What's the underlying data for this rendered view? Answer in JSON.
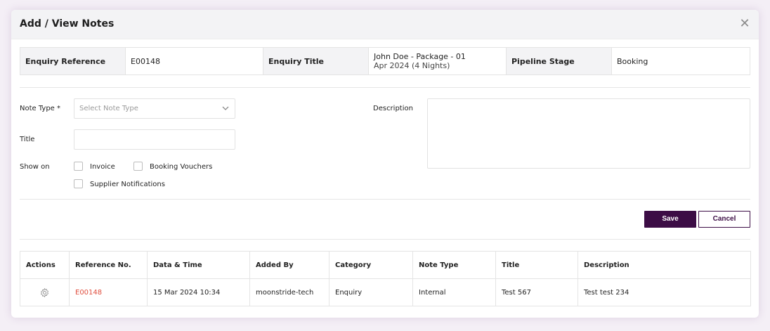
{
  "modal": {
    "title": "Add / View Notes",
    "close_icon": "close-icon"
  },
  "enquiry": {
    "reference_label": "Enquiry Reference",
    "reference_value": "E00148",
    "title_label": "Enquiry Title",
    "title_value_line1": "John Doe - Package - 01",
    "title_value_line2": "Apr 2024 (4 Nights)",
    "stage_label": "Pipeline Stage",
    "stage_value": "Booking"
  },
  "form": {
    "note_type_label": "Note Type *",
    "note_type_placeholder": "Select Note Type",
    "title_label": "Title",
    "title_value": "",
    "show_on_label": "Show on",
    "invoice_label": "Invoice",
    "booking_vouchers_label": "Booking Vouchers",
    "supplier_notifications_label": "Supplier Notifications",
    "description_label": "Description",
    "description_value": "",
    "save_label": "Save",
    "cancel_label": "Cancel"
  },
  "table": {
    "columns": [
      "Actions",
      "Reference No.",
      "Data & Time",
      "Added By",
      "Category",
      "Note Type",
      "Title",
      "Description"
    ],
    "rows": [
      {
        "reference": "E00148",
        "datetime": "15 Mar 2024 10:34",
        "added_by": "moonstride-tech",
        "category": "Enquiry",
        "note_type": "Internal",
        "title": "Test 567",
        "description": "Test test 234"
      }
    ]
  },
  "colors": {
    "primary": "#3c0d45",
    "link": "#e05040",
    "header_bg": "#f3f3f5"
  }
}
